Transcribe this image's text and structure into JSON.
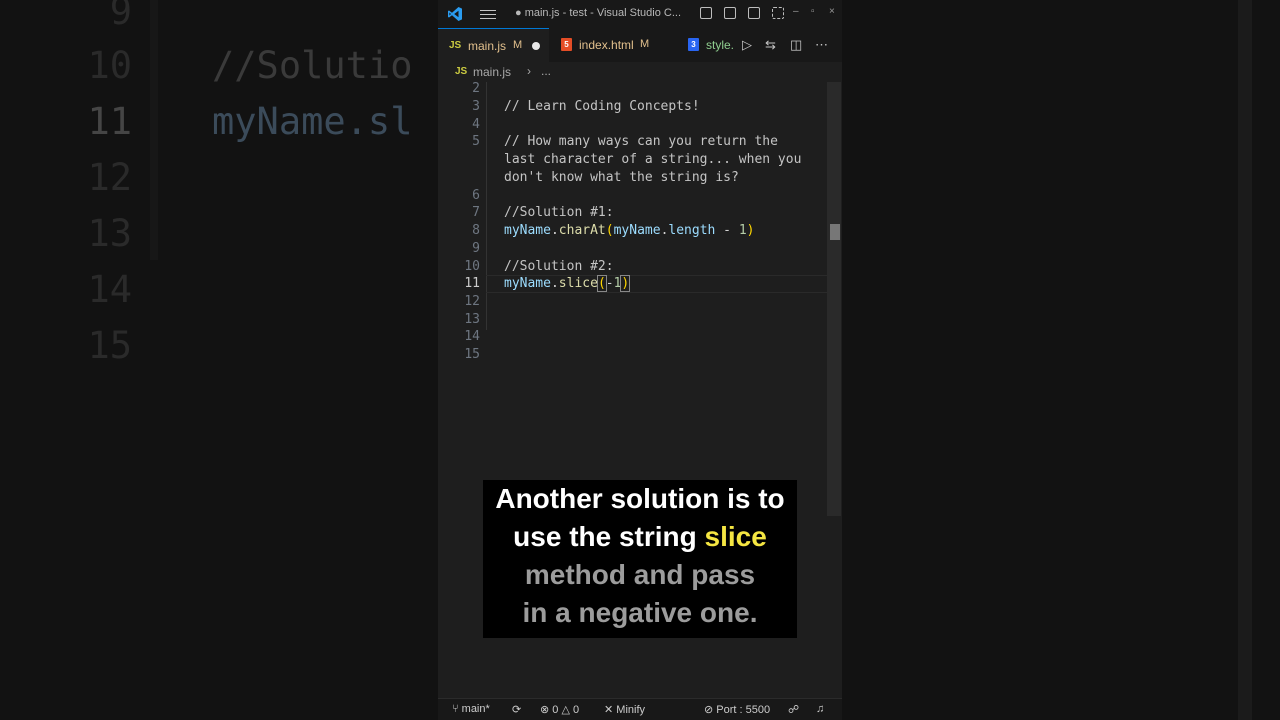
{
  "background": {
    "line_numbers": [
      "9",
      "10",
      "11",
      "12",
      "13",
      "14",
      "15"
    ],
    "code_fragments": [
      "//Solutio",
      "myName.sl"
    ]
  },
  "titlebar": {
    "title": "● main.js - test - Visual Studio C..."
  },
  "tabs": [
    {
      "label": "main.js",
      "status": "M",
      "icon": "JS"
    },
    {
      "label": "index.html",
      "status": "M",
      "icon": "5"
    },
    {
      "label": "style.",
      "icon": "3"
    }
  ],
  "breadcrumb": {
    "icon": "JS",
    "file": "main.js",
    "separator": "›",
    "more": "..."
  },
  "editor": {
    "line_numbers": [
      "2",
      "3",
      "4",
      "5",
      "",
      "",
      "6",
      "7",
      "8",
      "9",
      "10",
      "11",
      "12",
      "13",
      "14",
      "15"
    ],
    "active_line": "11",
    "lines": {
      "l3": "// Learn Coding Concepts!",
      "l5a": "// How many ways can you return the",
      "l5b": "last character of a string... when you",
      "l5c": "don't know what the string is?",
      "l7": "//Solution #1:",
      "l8_obj": "myName",
      "l8_dot": ".",
      "l8_fn": "charAt",
      "l8_open": "(",
      "l8_arg": "myName",
      "l8_dot2": ".",
      "l8_prop": "length",
      "l8_op": " - ",
      "l8_num": "1",
      "l8_close": ")",
      "l10": "//Solution #2:",
      "l11_obj": "myName",
      "l11_dot": ".",
      "l11_fn": "slice",
      "l11_open": "(",
      "l11_op": "-",
      "l11_num": "1",
      "l11_close": ")"
    }
  },
  "statusbar": {
    "branch": "main*",
    "errors": "0",
    "warnings": "0",
    "minify": "Minify",
    "port": "Port : 5500"
  },
  "caption": {
    "line1": "Another solution is to",
    "line2_a": "use the string ",
    "line2_b": "slice",
    "line3": "method and pass",
    "line4": "in a negative one."
  },
  "colors": {
    "accent": "#0078d4",
    "caption_highlight": "#f5e642",
    "modified": "#e2c08d"
  }
}
